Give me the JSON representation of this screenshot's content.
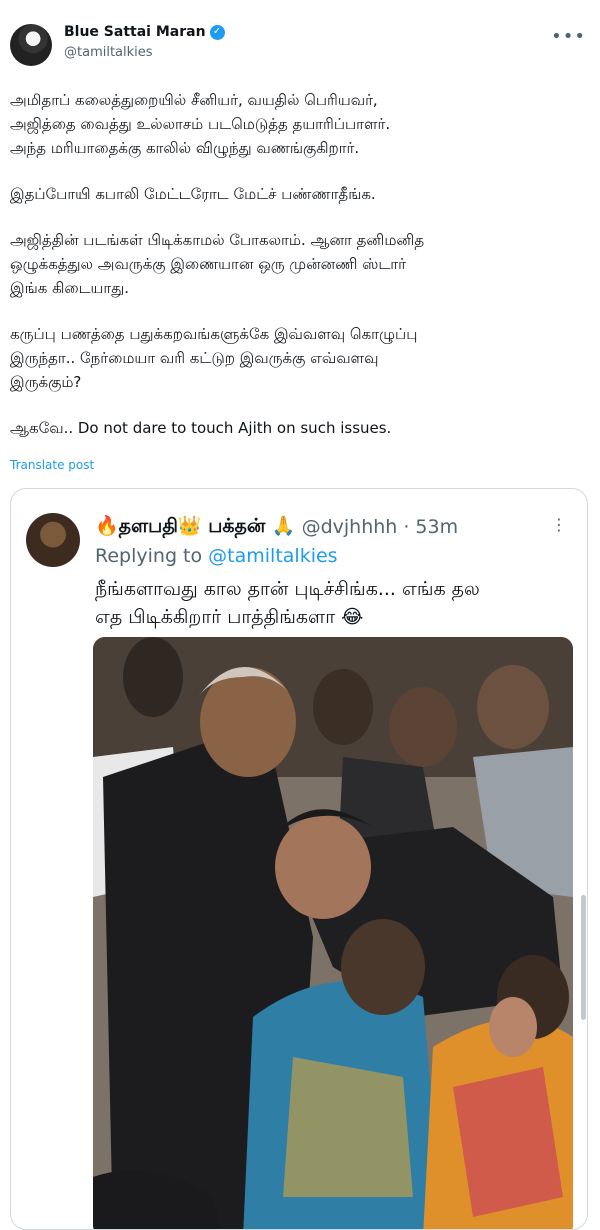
{
  "post": {
    "display_name": "Blue Sattai Maran",
    "handle": "@tamiltalkies",
    "more_icon": "•••",
    "body": [
      [
        "அமிதாப் கலைத்துறையில் சீனியர், வயதில் பெரியவர்,",
        "அஜித்தை வைத்து உல்லாசம் படமெடுத்த தயாரிப்பாளர்.",
        "அந்த மரியாதைக்கு காலில் விழுந்து வணங்குகிறார்."
      ],
      [
        "இதப்போயி கபாலி மேட்டரோட மேட்ச் பண்ணாதீங்க."
      ],
      [
        "அஜித்தின் படங்கள் பிடிக்காமல் போகலாம். ஆனா தனிமனித",
        "ஒழுக்கத்துல அவருக்கு இணையான ஒரு முன்னணி ஸ்டார்",
        "இங்க கிடையாது."
      ],
      [
        "கருப்பு பணத்தை பதுக்கறவங்களுக்கே இவ்வளவு கொழுப்பு",
        "இருந்தா.. நேர்மையா வரி கட்டுற இவருக்கு எவ்வளவு",
        "இருக்கும்?"
      ],
      [
        "ஆகவே.. Do not dare to touch Ajith on such issues."
      ]
    ],
    "translate_label": "Translate post"
  },
  "quote": {
    "name_prefix": "🔥தளபதி",
    "name_crown": "👑",
    "name_suffix": "பக்தன்",
    "name_emoji": "🙏",
    "handle": "@dvjhhhh",
    "separator": "·",
    "time": "53m",
    "more_icon": "⋮",
    "reply_prefix": "Replying to",
    "reply_handle": "@tamiltalkies",
    "text_lines": [
      "நீங்களாவது கால தான் புடிச்சிங்க... எங்க தல",
      "எத பிடிக்கிறார் பாத்திங்களா 😂"
    ]
  },
  "colors": {
    "accent": "#1d9bf0",
    "muted": "#536471",
    "border": "#cfd9de"
  },
  "icons": {
    "verified": "verified-badge-icon",
    "more": "more-options-icon"
  }
}
